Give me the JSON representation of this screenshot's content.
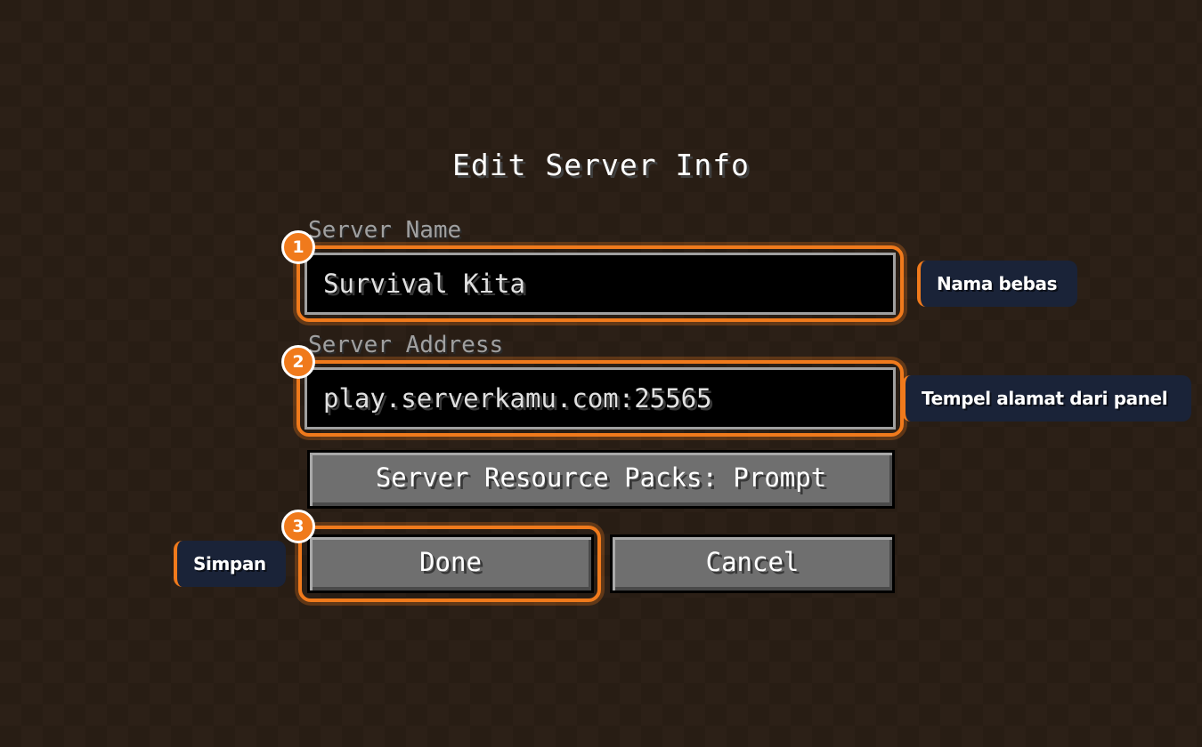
{
  "dialog": {
    "title": "Edit Server Info",
    "server_name": {
      "label": "Server Name",
      "value": "Survival Kita"
    },
    "server_address": {
      "label": "Server Address",
      "value": "play.serverkamu.com:25565"
    },
    "resource_packs_button": "Server Resource Packs: Prompt",
    "done_button": "Done",
    "cancel_button": "Cancel"
  },
  "annotations": {
    "badges": [
      "1",
      "2",
      "3"
    ],
    "tips": [
      "Nama bebas",
      "Tempel alamat dari panel",
      "Simpan"
    ],
    "accent_color": "#f07a1c",
    "tip_background": "#1a2338"
  }
}
